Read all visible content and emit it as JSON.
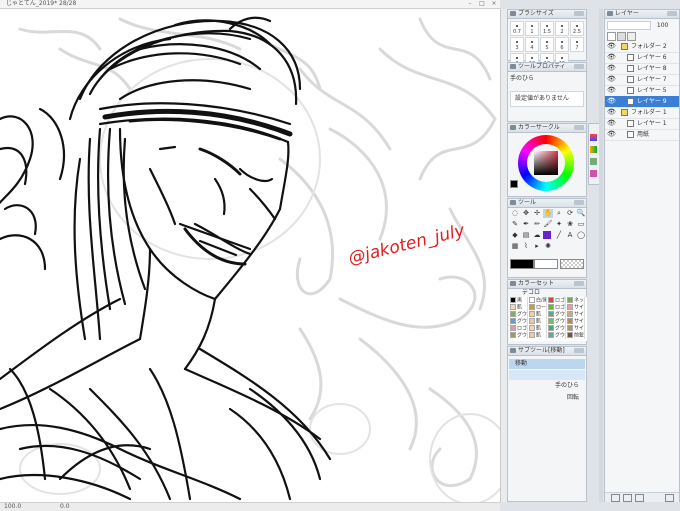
{
  "window": {
    "title": "じゃとてん_2019* 28/28"
  },
  "status": {
    "zoom": "100.0",
    "angle": "0.0"
  },
  "watermark": "@jakoten_july",
  "brush_size_panel": {
    "title": "ブラシサイズ",
    "sizes": [
      "0.7",
      "1",
      "1.5",
      "2",
      "2.5",
      "3",
      "4",
      "5",
      "6",
      "7",
      "8",
      "10",
      "12",
      "15"
    ]
  },
  "tool_property": {
    "title": "ツールプロパティ",
    "tool_name": "手のひら",
    "message": "設定値がありません"
  },
  "color_circle": {
    "title": "カラーサークル"
  },
  "tool_panel": {
    "title": "ツール"
  },
  "color_set": {
    "title": "カラーセット",
    "set_name": "デコロ",
    "rows": [
      {
        "c1": "黒",
        "c2": "白/黒",
        "c3": "ロゴ",
        "c4": "ネックまとい"
      },
      {
        "c1": "肌",
        "c2": "ロール",
        "c3": "ロゴ",
        "c4": "サイドギ"
      },
      {
        "c1": "グウェ",
        "c2": "肌",
        "c3": "グウェ",
        "c4": "サイド"
      },
      {
        "c1": "グウェ",
        "c2": "肌",
        "c3": "グウェ",
        "c4": "サイド"
      },
      {
        "c1": "ロゴ",
        "c2": "肌",
        "c3": "グウェ",
        "c4": "サイド"
      },
      {
        "c1": "グウェ",
        "c2": "肌",
        "c3": "グウェ",
        "c4": "前髪"
      }
    ]
  },
  "sub_tool": {
    "title": "サブツール[移動]",
    "items": [
      "移動",
      "手のひら"
    ],
    "extra": "回転"
  },
  "layer_panel": {
    "title": "レイヤー",
    "opacity": "100",
    "layers": [
      {
        "name": "フォルダー 2",
        "type": "folder"
      },
      {
        "name": "レイヤー 6",
        "type": "layer"
      },
      {
        "name": "レイヤー 8",
        "type": "layer"
      },
      {
        "name": "レイヤー 7",
        "type": "layer"
      },
      {
        "name": "レイヤー 5",
        "type": "layer"
      },
      {
        "name": "レイヤー 9",
        "type": "layer",
        "selected": true
      },
      {
        "name": "フォルダー 1",
        "type": "folder"
      },
      {
        "name": "レイヤー 1",
        "type": "layer"
      },
      {
        "name": "用紙",
        "type": "paper"
      }
    ]
  },
  "colors": {
    "accent_select": "#3a7fd5",
    "watermark_red": "#e02020",
    "main_color": "#000000",
    "sub_color": "#ffffff",
    "sub_tool_selected": "#bcd6ee"
  },
  "icons": [
    "hand-icon",
    "eye-icon",
    "folder-icon",
    "pen-icon",
    "menu-icon",
    "magnifier-icon",
    "move-icon",
    "lasso-icon",
    "eyedropper-icon",
    "pencil-icon",
    "brush-icon",
    "eraser-icon",
    "fill-icon",
    "gradient-icon",
    "text-icon",
    "balloon-icon"
  ]
}
